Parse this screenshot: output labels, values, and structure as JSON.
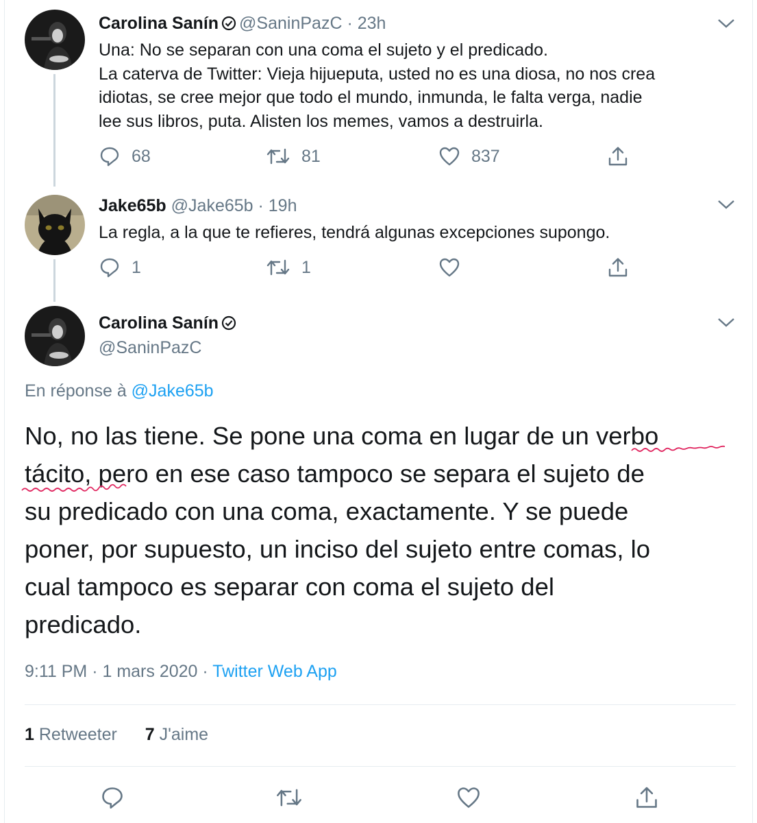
{
  "tweets": [
    {
      "name": "Carolina Sanín",
      "handle": "@SaninPazC",
      "time": "23h",
      "verified": true,
      "lines": [
        "Una: No se separan con una coma el sujeto y el predicado.",
        "La caterva de Twitter: Vieja hijueputa, usted no es una diosa, no nos crea",
        "idiotas, se cree mejor que todo el mundo, inmunda, le falta verga, nadie",
        "lee sus libros, puta. Alisten los memes, vamos a destruirla."
      ],
      "replies": "68",
      "retweets": "81",
      "likes": "837"
    },
    {
      "name": "Jake65b",
      "handle": "@Jake65b",
      "time": "19h",
      "verified": false,
      "lines": [
        "La regla, a la que te refieres, tendrá algunas excepciones supongo."
      ],
      "replies": "1",
      "retweets": "1",
      "likes": ""
    }
  ],
  "focus": {
    "name": "Carolina Sanín",
    "handle": "@SaninPazC",
    "reply_prefix": "En réponse à ",
    "reply_handle": "@Jake65b",
    "lines": [
      "No, no las tiene. Se pone una coma en lugar de un verbo",
      "tácito, pero en ese caso tampoco se separa el sujeto de",
      "su predicado con una coma, exactamente. Y se puede",
      "poner, por supuesto, un inciso del sujeto entre comas, lo",
      "cual tampoco es separar con coma el sujeto del",
      "predicado."
    ],
    "time": "9:11 PM",
    "date": "1 mars 2020",
    "source": "Twitter Web App",
    "retweet_count": "1",
    "retweet_label": "Retweeter",
    "like_count": "7",
    "like_label": "J'aime"
  },
  "separator": " · ",
  "colors": {
    "link": "#1da1f2",
    "muted": "#657786",
    "text": "#14171a",
    "divider": "#e6ecf0",
    "spellcheck": "#e0245e"
  }
}
